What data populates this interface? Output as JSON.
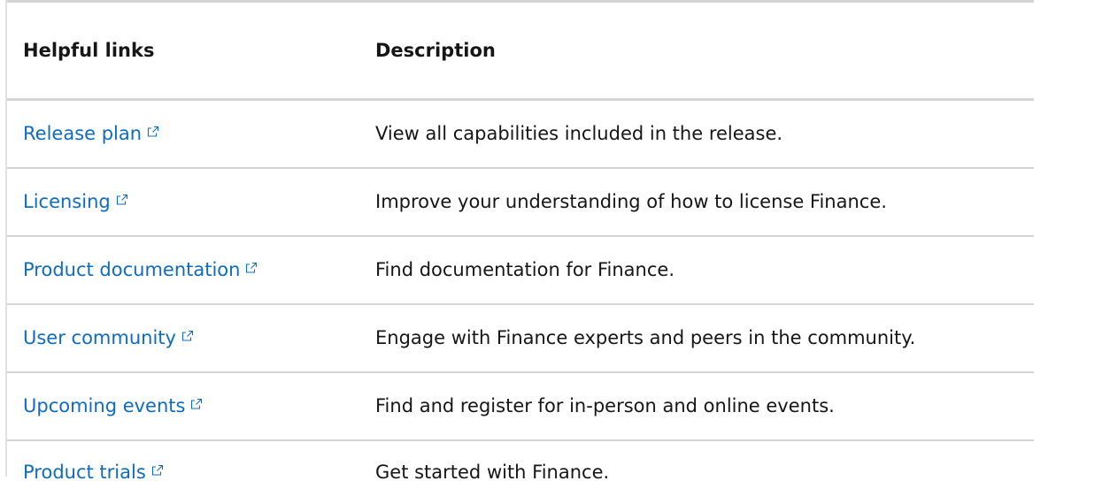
{
  "table": {
    "headers": {
      "links": "Helpful links",
      "description": "Description"
    },
    "rows": [
      {
        "link": "Release plan",
        "description": "View all capabilities included in the release."
      },
      {
        "link": "Licensing",
        "description": "Improve your understanding of how to license Finance."
      },
      {
        "link": "Product documentation",
        "description": "Find documentation for Finance."
      },
      {
        "link": "User community",
        "description": "Engage with Finance experts and peers in the community."
      },
      {
        "link": "Upcoming events",
        "description": "Find and register for in-person and online events."
      },
      {
        "link": "Product trials",
        "description": "Get started with Finance."
      }
    ]
  },
  "icons": {
    "external_link": "external-link-icon"
  },
  "colors": {
    "link": "#0f6cbd",
    "text": "#161616",
    "divider": "#d4d4d4"
  }
}
